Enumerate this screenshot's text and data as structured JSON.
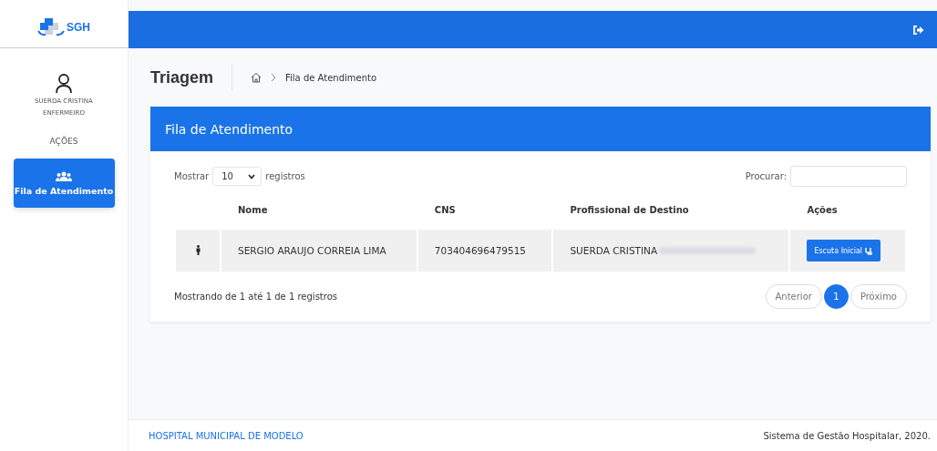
{
  "logo": {
    "text": "SGH"
  },
  "user": {
    "name": "SUERDA CRISTINA",
    "role": "ENFERMEIRO"
  },
  "sidebar": {
    "section": "AÇÕES",
    "items": [
      {
        "label": "Fila de Atendimento",
        "selected": true
      }
    ]
  },
  "page": {
    "title": "Triagem",
    "breadcrumb": "Fila de Atendimento"
  },
  "card": {
    "title": "Fila de Atendimento",
    "length": {
      "before": "Mostrar",
      "value": "10",
      "after": "registros"
    },
    "search": {
      "label": "Procurar:"
    },
    "table": {
      "columns": [
        "Nome",
        "CNS",
        "Profissional de Destino",
        "Ações"
      ],
      "rows": [
        {
          "name": "SERGIO ARAUJO CORREIA LIMA",
          "cns": "703404696479515",
          "professional": "SUERDA CRISTINA",
          "action": "Escuta Inicial"
        }
      ]
    },
    "info": "Mostrando de 1 até 1 de 1 registros",
    "pagination": {
      "previous": "Anterior",
      "pages": [
        {
          "label": "1",
          "selected": true
        }
      ],
      "next": "Próximo"
    }
  },
  "footer": {
    "left": "HOSPITAL MUNICIPAL DE MODELO",
    "right": "Sistema de Gestão Hospitalar, 2020."
  }
}
